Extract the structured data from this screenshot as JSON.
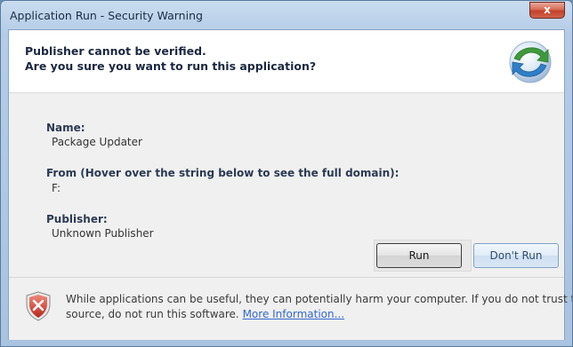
{
  "window": {
    "title": "Application Run - Security Warning",
    "close_symbol": "x"
  },
  "header": {
    "line1": "Publisher cannot be verified.",
    "line2": "Are you sure you want to run this application?",
    "icon": "globe-arrows-icon"
  },
  "details": {
    "name_label": "Name:",
    "name_value": "Package Updater",
    "from_label": "From (Hover over the string below to see the full domain):",
    "from_value": "F:",
    "publisher_label": "Publisher:",
    "publisher_value": "Unknown Publisher"
  },
  "buttons": {
    "run": "Run",
    "dont_run": "Don't Run"
  },
  "footer": {
    "icon": "shield-error-icon",
    "warning_line1": "While applications can be useful, they can potentially harm your computer. If you do not trust the",
    "warning_line2": "source, do not run this software.",
    "more_info_link": "More Information..."
  }
}
